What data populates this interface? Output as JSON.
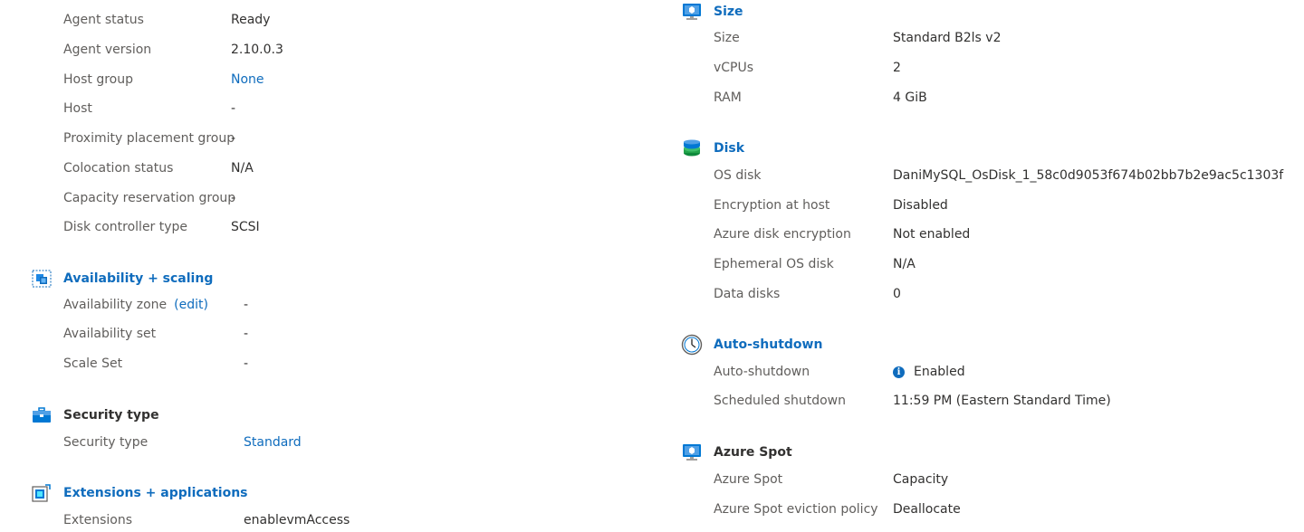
{
  "left": {
    "top_rows": [
      {
        "label": "Agent status",
        "value": "Ready"
      },
      {
        "label": "Agent version",
        "value": "2.10.0.3"
      },
      {
        "label": "Host group",
        "value": "None"
      },
      {
        "label": "Host",
        "value": "-"
      },
      {
        "label": "Proximity placement group",
        "value": "-"
      },
      {
        "label": "Colocation status",
        "value": "N/A"
      },
      {
        "label": "Capacity reservation group",
        "value": "-"
      },
      {
        "label": "Disk controller type",
        "value": "SCSI"
      }
    ],
    "availability": {
      "title": "Availability + scaling",
      "icon": "availability-scaling-icon",
      "zone_label": "Availability zone",
      "zone_edit": "(edit)",
      "zone_value": "-",
      "set_label": "Availability set",
      "set_value": "-",
      "scaleset_label": "Scale Set",
      "scaleset_value": "-"
    },
    "security": {
      "title": "Security type",
      "icon": "security-briefcase-icon",
      "label": "Security type",
      "value": "Standard"
    },
    "extensions": {
      "title": "Extensions + applications",
      "icon": "extensions-icon",
      "label": "Extensions",
      "value": "enablevmAccess"
    }
  },
  "right": {
    "size": {
      "title": "Size",
      "icon": "monitor-icon",
      "rows": [
        {
          "label": "Size",
          "value": "Standard B2ls v2"
        },
        {
          "label": "vCPUs",
          "value": "2"
        },
        {
          "label": "RAM",
          "value": "4 GiB"
        }
      ]
    },
    "disk": {
      "title": "Disk",
      "icon": "disk-icon",
      "rows": [
        {
          "label": "OS disk",
          "value": "DaniMySQL_OsDisk_1_58c0d9053f674b02bb7b2e9ac5c1303f"
        },
        {
          "label": "Encryption at host",
          "value": "Disabled"
        },
        {
          "label": "Azure disk encryption",
          "value": "Not enabled"
        },
        {
          "label": "Ephemeral OS disk",
          "value": "N/A"
        },
        {
          "label": "Data disks",
          "value": "0"
        }
      ]
    },
    "autoshutdown": {
      "title": "Auto-shutdown",
      "icon": "clock-icon",
      "label": "Auto-shutdown",
      "value": "Enabled",
      "info_icon": "info-icon",
      "sched_label": "Scheduled shutdown",
      "sched_value": "11:59 PM (Eastern Standard Time)"
    },
    "spot": {
      "title": "Azure Spot",
      "icon": "monitor-icon",
      "rows": [
        {
          "label": "Azure Spot",
          "value": "Capacity"
        },
        {
          "label": "Azure Spot eviction policy",
          "value": "Deallocate"
        }
      ]
    }
  },
  "colors": {
    "link": "#0f6cbd",
    "label": "#605e5c",
    "value": "#323130"
  }
}
